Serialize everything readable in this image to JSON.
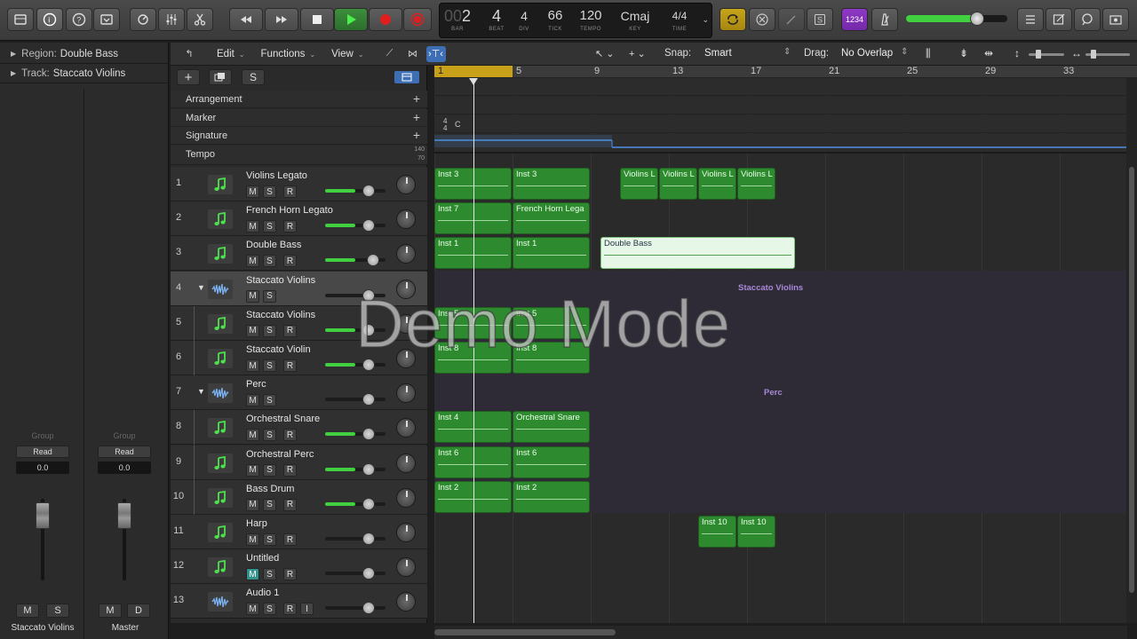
{
  "lcd": {
    "bar": "2",
    "bar_prefix": "00",
    "beat": "4",
    "div": "4",
    "tick": "66",
    "tempo": "120",
    "key": "Cmaj",
    "time": "4/4",
    "labels": {
      "bar": "BAR",
      "beat": "BEAT",
      "div": "DIV",
      "tick": "TICK",
      "tempo": "TEMPO",
      "key": "KEY",
      "time": "TIME"
    }
  },
  "count_in": "1234",
  "inspector": {
    "region_label": "Region:",
    "region_name": "Double Bass",
    "track_label": "Track:",
    "track_name": "Staccato Violins",
    "strip1": {
      "group": "Group",
      "automation": "Read",
      "value": "0.0",
      "m": "M",
      "s": "S",
      "name": "Staccato Violins"
    },
    "strip2": {
      "group": "Group",
      "automation": "Read",
      "value": "0.0",
      "m": "M",
      "d": "D",
      "name": "Master"
    }
  },
  "toolbar": {
    "edit": "Edit",
    "functions": "Functions",
    "view": "View",
    "snap_label": "Snap:",
    "snap_value": "Smart",
    "drag_label": "Drag:",
    "drag_value": "No Overlap"
  },
  "globals": {
    "arrangement": "Arrangement",
    "marker": "Marker",
    "signature": "Signature",
    "tempo": "Tempo",
    "tempo_hi": "140",
    "tempo_lo": "70",
    "sig_top": "4",
    "sig_bottom": "4",
    "sig_key": "C"
  },
  "header_buttons": {
    "add": "+",
    "s": "S"
  },
  "bars": [
    "1",
    "5",
    "9",
    "13",
    "17",
    "21",
    "25",
    "29",
    "33"
  ],
  "tracks": [
    {
      "num": "1",
      "name": "Violins Legato",
      "type": "inst",
      "m": "M",
      "s": "S",
      "r": "R",
      "vol": 0.7
    },
    {
      "num": "2",
      "name": "French Horn Legato",
      "type": "inst",
      "m": "M",
      "s": "S",
      "r": "R",
      "vol": 0.7
    },
    {
      "num": "3",
      "name": "Double Bass",
      "type": "inst",
      "m": "M",
      "s": "S",
      "r": "R",
      "vol": 0.78
    },
    {
      "num": "4",
      "name": "Staccato Violins",
      "type": "folder",
      "m": "M",
      "s": "S",
      "r": "",
      "vol": 0.7
    },
    {
      "num": "5",
      "name": "Staccato Violins",
      "type": "inst",
      "m": "M",
      "s": "S",
      "r": "R",
      "vol": 0.7
    },
    {
      "num": "6",
      "name": "Staccato Violin",
      "type": "inst",
      "m": "M",
      "s": "S",
      "r": "R",
      "vol": 0.7
    },
    {
      "num": "7",
      "name": "Perc",
      "type": "folder",
      "m": "M",
      "s": "S",
      "r": "",
      "vol": 0.7
    },
    {
      "num": "8",
      "name": "Orchestral Snare",
      "type": "inst",
      "m": "M",
      "s": "S",
      "r": "R",
      "vol": 0.7
    },
    {
      "num": "9",
      "name": "Orchestral Perc",
      "type": "inst",
      "m": "M",
      "s": "S",
      "r": "R",
      "vol": 0.7
    },
    {
      "num": "10",
      "name": "Bass Drum",
      "type": "inst",
      "m": "M",
      "s": "S",
      "r": "R",
      "vol": 0.7
    },
    {
      "num": "11",
      "name": "Harp",
      "type": "inst",
      "m": "M",
      "s": "S",
      "r": "R",
      "vol": 0.7
    },
    {
      "num": "12",
      "name": "Untitled",
      "type": "inst",
      "m": "M",
      "s": "S",
      "r": "R",
      "vol": 0.7
    },
    {
      "num": "13",
      "name": "Audio 1",
      "type": "audio",
      "m": "M",
      "s": "S",
      "r": "R",
      "i": "I",
      "vol": 0.7
    }
  ],
  "regions": [
    {
      "name": "Inst 3",
      "track": 0,
      "start": 1,
      "end": 5
    },
    {
      "name": "Inst 3",
      "track": 0,
      "start": 5,
      "end": 9
    },
    {
      "name": "Violins L",
      "track": 0,
      "start": 10.5,
      "end": 12.5
    },
    {
      "name": "Violins L",
      "track": 0,
      "start": 12.5,
      "end": 14.5
    },
    {
      "name": "Violins L",
      "track": 0,
      "start": 14.5,
      "end": 16.5
    },
    {
      "name": "Violins L",
      "track": 0,
      "start": 16.5,
      "end": 18.5
    },
    {
      "name": "Inst 7",
      "track": 1,
      "start": 1,
      "end": 5
    },
    {
      "name": "French Horn Lega",
      "track": 1,
      "start": 5,
      "end": 9
    },
    {
      "name": "Inst 1",
      "track": 2,
      "start": 1,
      "end": 5
    },
    {
      "name": "Inst 1",
      "track": 2,
      "start": 5,
      "end": 9
    },
    {
      "name": "Double Bass",
      "track": 2,
      "start": 9.5,
      "end": 19.5,
      "selected": true
    },
    {
      "name": "Inst 5",
      "track": 4,
      "start": 1,
      "end": 5
    },
    {
      "name": "Inst 5",
      "track": 4,
      "start": 5,
      "end": 9
    },
    {
      "name": "Inst 8",
      "track": 5,
      "start": 1,
      "end": 5
    },
    {
      "name": "Inst 8",
      "track": 5,
      "start": 5,
      "end": 9
    },
    {
      "name": "Inst 4",
      "track": 7,
      "start": 1,
      "end": 5
    },
    {
      "name": "Orchestral Snare",
      "track": 7,
      "start": 5,
      "end": 9
    },
    {
      "name": "Inst 6",
      "track": 8,
      "start": 1,
      "end": 5
    },
    {
      "name": "Inst 6",
      "track": 8,
      "start": 5,
      "end": 9
    },
    {
      "name": "Inst 2",
      "track": 9,
      "start": 1,
      "end": 5
    },
    {
      "name": "Inst 2",
      "track": 9,
      "start": 5,
      "end": 9
    },
    {
      "name": "Inst 10",
      "track": 10,
      "start": 14.5,
      "end": 16.5
    },
    {
      "name": "Inst 10",
      "track": 10,
      "start": 16.5,
      "end": 18.5
    }
  ],
  "folder_labels": {
    "staccato": "Staccato Violins",
    "perc": "Perc"
  },
  "watermark": "Demo Mode",
  "colors": {
    "region": "#2e8a2e",
    "cycle": "#c9a019",
    "accent_purple": "#8e39c5",
    "meter": "#40d040"
  }
}
